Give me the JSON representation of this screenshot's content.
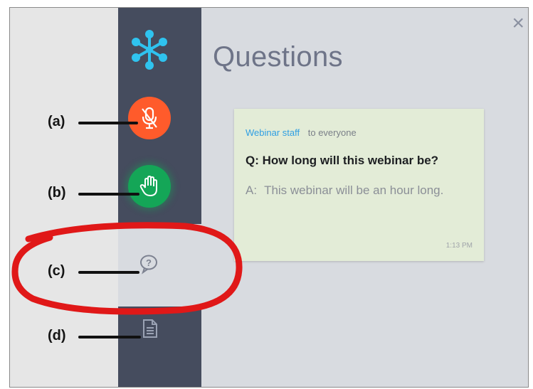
{
  "panel": {
    "title": "Questions",
    "close_glyph": "×"
  },
  "question": {
    "sender": "Webinar staff",
    "recipient": "to everyone",
    "question_text": "Q: How long will this webinar be?",
    "answer_prefix": "A:",
    "answer_text": "This webinar will be an hour long.",
    "time": "1:13 PM"
  },
  "callouts": {
    "a": "(a)",
    "b": "(b)",
    "c": "(c)",
    "d": "(d)"
  },
  "sidebar": {
    "icons": [
      "snowflake-logo-icon",
      "microphone-muted-icon",
      "raise-hand-icon",
      "question-bubble-icon",
      "document-icon"
    ]
  },
  "colors": {
    "sidebar_bg": "#454c5e",
    "mute_button": "#ff5b2b",
    "raise_hand_button": "#14a657",
    "logo": "#2fc3ef",
    "card_bg": "#e3ecd7",
    "sender_link": "#2f9fe3",
    "annotation_red": "#e01818"
  }
}
